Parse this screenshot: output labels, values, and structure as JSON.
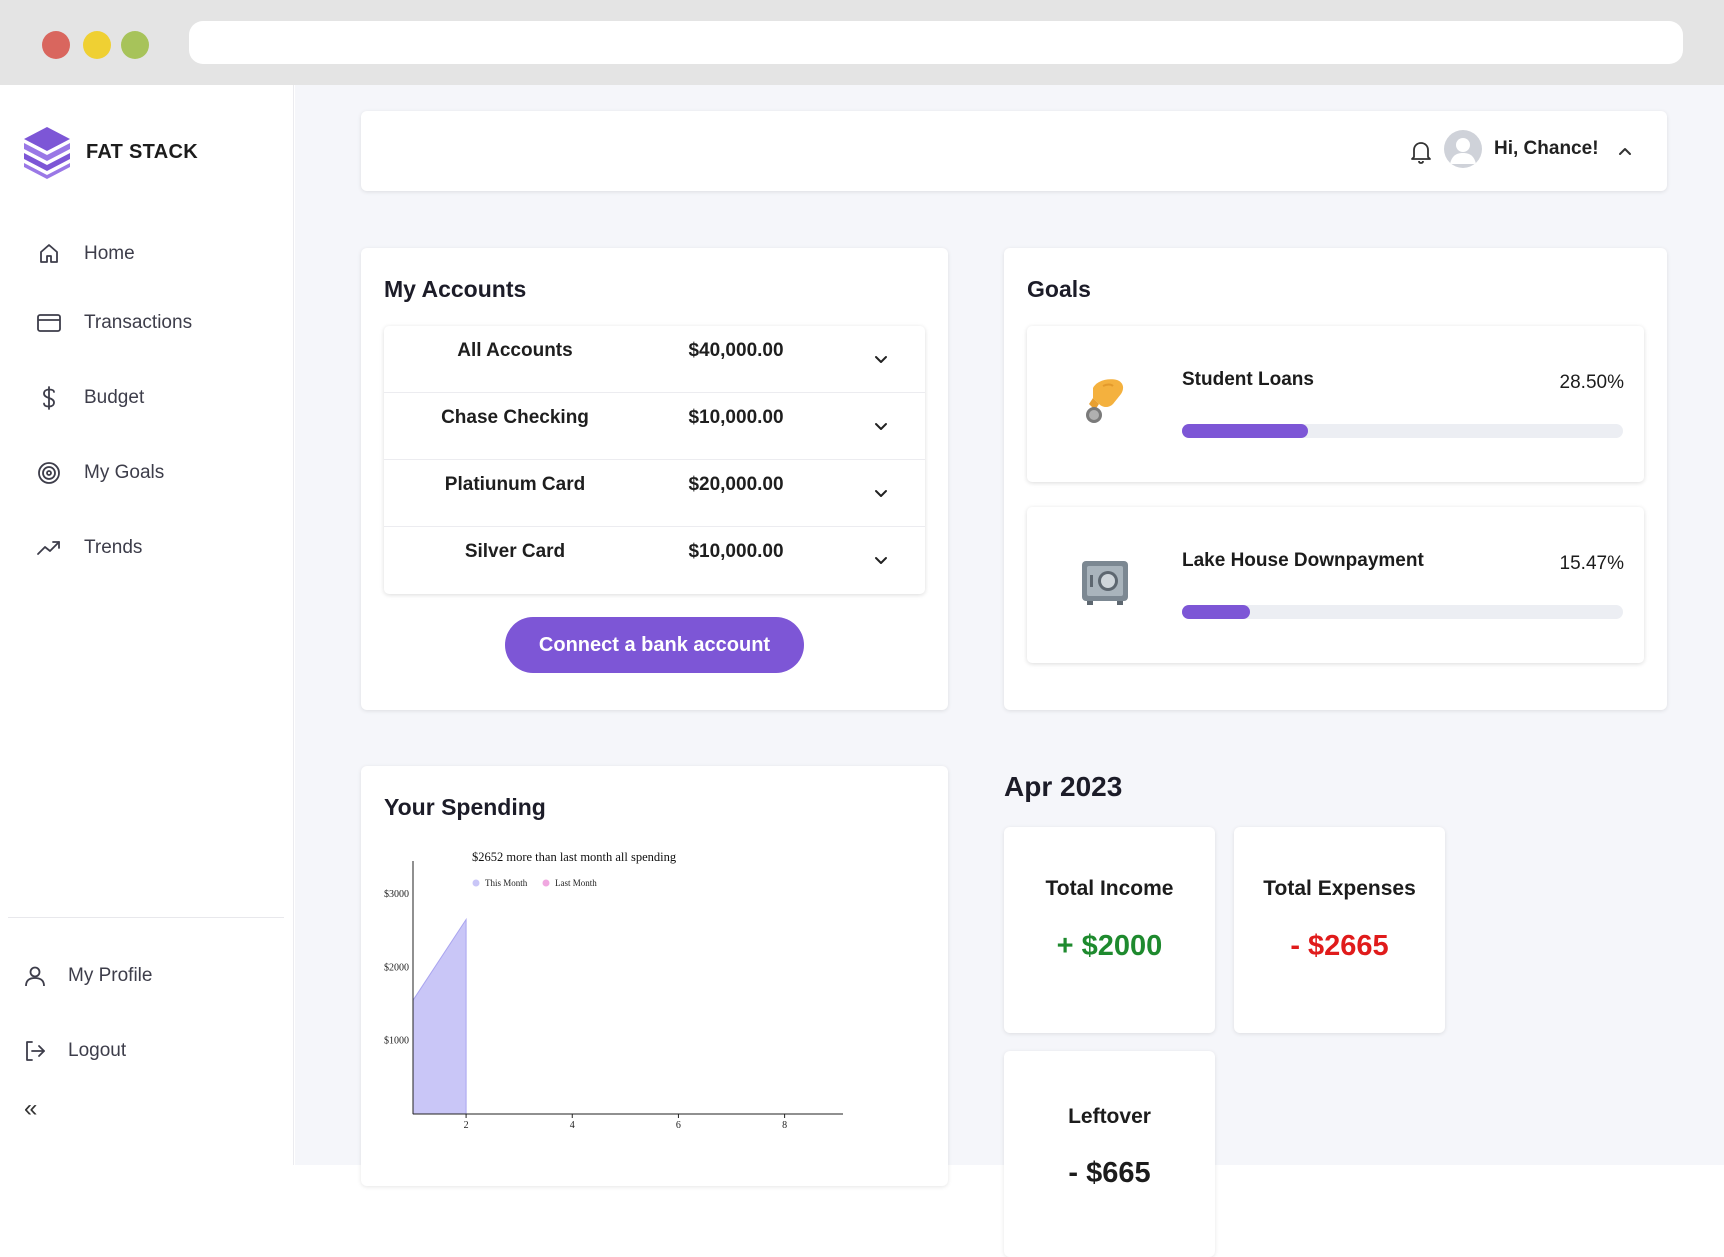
{
  "app": {
    "name": "FAT STACK"
  },
  "sidebar": {
    "items": [
      {
        "label": "Home",
        "icon": "home-icon"
      },
      {
        "label": "Transactions",
        "icon": "credit-card-icon"
      },
      {
        "label": "Budget",
        "icon": "dollar-icon"
      },
      {
        "label": "My Goals",
        "icon": "target-icon"
      },
      {
        "label": "Trends",
        "icon": "trending-up-icon"
      }
    ],
    "bottom": [
      {
        "label": "My Profile",
        "icon": "user-icon"
      },
      {
        "label": "Logout",
        "icon": "logout-icon"
      }
    ],
    "collapse_label": "«"
  },
  "header": {
    "greeting": "Hi, Chance!"
  },
  "accounts": {
    "title": "My Accounts",
    "rows": [
      {
        "name": "All Accounts",
        "amount": "$40,000.00"
      },
      {
        "name": "Chase Checking",
        "amount": "$10,000.00"
      },
      {
        "name": "Platiunum Card",
        "amount": "$20,000.00"
      },
      {
        "name": "Silver Card",
        "amount": "$10,000.00"
      }
    ],
    "connect_label": "Connect a bank account"
  },
  "goals": {
    "title": "Goals",
    "items": [
      {
        "name": "Student Loans",
        "percent_label": "28.50%",
        "progress": 0.285,
        "icon": "hand-coin-icon"
      },
      {
        "name": "Lake House Downpayment",
        "percent_label": "15.47%",
        "progress": 0.1547,
        "icon": "safe-icon"
      }
    ]
  },
  "spending": {
    "title": "Your Spending"
  },
  "chart_data": {
    "type": "area",
    "title": "$2652 more than last month all spending",
    "series": [
      {
        "name": "This Month",
        "color": "#c9c6f7",
        "x": [
          1,
          2
        ],
        "values": [
          1550,
          2652
        ]
      },
      {
        "name": "Last Month",
        "color": "#f0a8e0",
        "x": [],
        "values": []
      }
    ],
    "y_ticks": [
      "$3000",
      "$2000",
      "$1000"
    ],
    "y_tick_values": [
      3000,
      2000,
      1000
    ],
    "x_ticks": [
      2,
      4,
      6,
      8
    ],
    "xlim": [
      1,
      9.1
    ],
    "ylim": [
      0,
      3450
    ],
    "legend_position": "top"
  },
  "summary": {
    "month": "Apr 2023",
    "income": {
      "label": "Total Income",
      "value": "+ $2000",
      "color": "#1e8a2e"
    },
    "expenses": {
      "label": "Total Expenses",
      "value": "- $2665",
      "color": "#e01b1b"
    },
    "leftover": {
      "label": "Leftover",
      "value": "- $665"
    }
  },
  "colors": {
    "accent": "#7d56d6",
    "background": "#f5f6fa"
  }
}
